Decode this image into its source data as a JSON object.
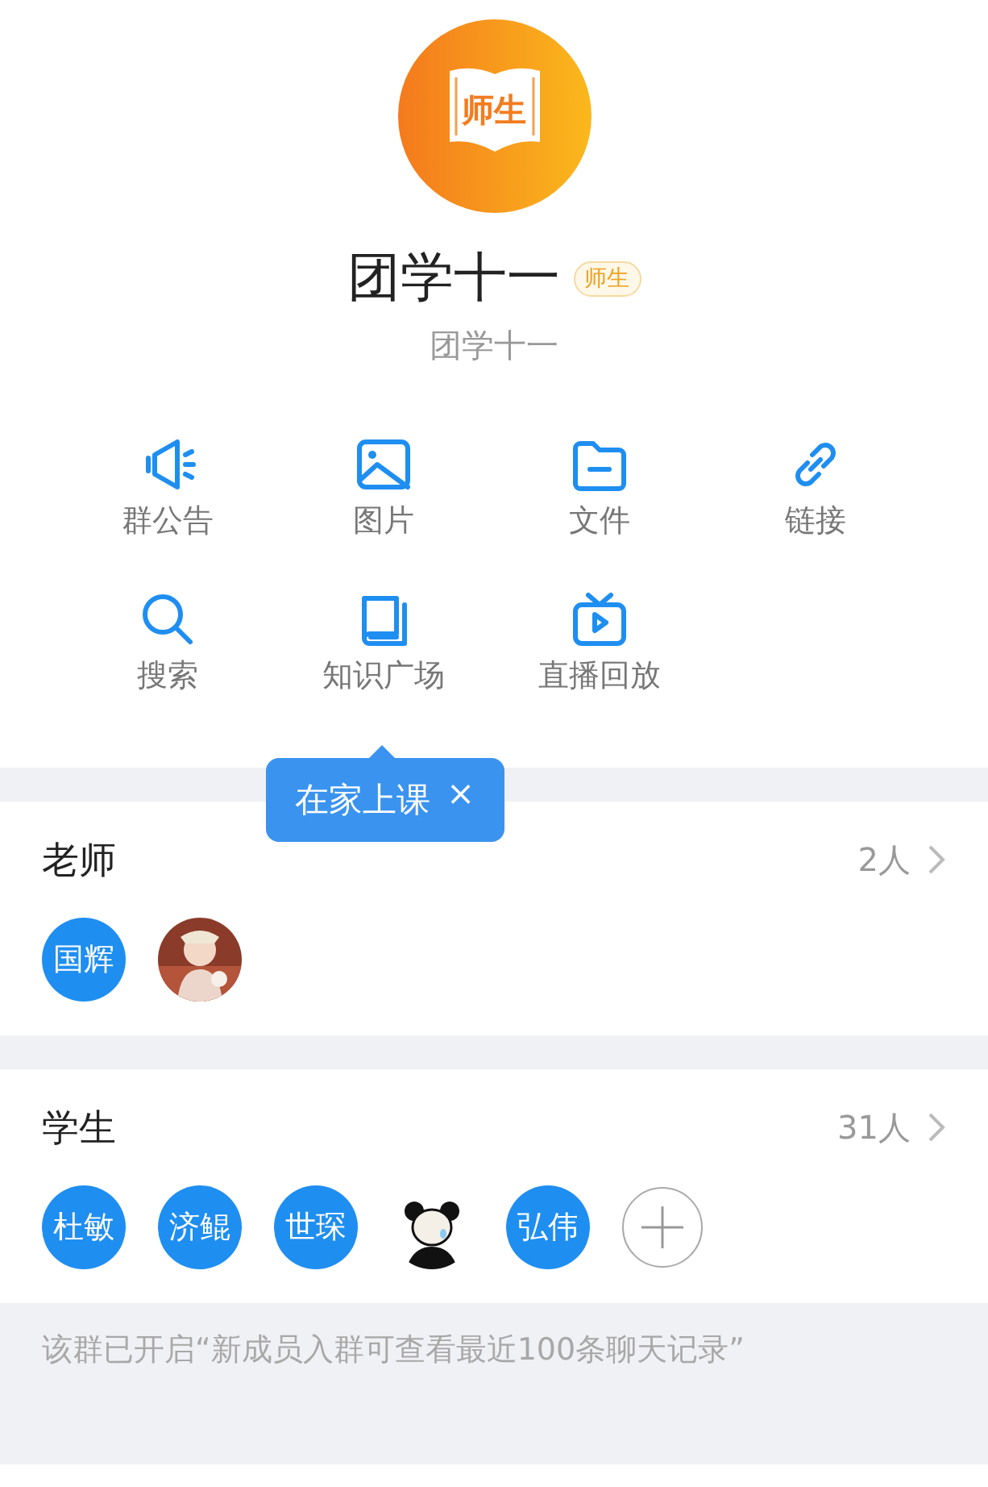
{
  "group": {
    "logo_text": "师生",
    "name": "团学十一",
    "badge": "师生",
    "subtitle": "团学十一"
  },
  "actions": [
    {
      "label": "群公告"
    },
    {
      "label": "图片"
    },
    {
      "label": "文件"
    },
    {
      "label": "链接"
    },
    {
      "label": "搜索"
    },
    {
      "label": "知识广场"
    },
    {
      "label": "直播回放"
    }
  ],
  "tooltip": {
    "text": "在家上课",
    "close": "×"
  },
  "sections": [
    {
      "title": "老师",
      "count": "2人",
      "members": [
        {
          "kind": "name",
          "name": "国辉"
        },
        {
          "kind": "picture"
        }
      ]
    },
    {
      "title": "学生",
      "count": "31人",
      "members": [
        {
          "kind": "name",
          "name": "杜敏"
        },
        {
          "kind": "name",
          "name": "济鲲"
        },
        {
          "kind": "name",
          "name": "世琛"
        },
        {
          "kind": "picture"
        },
        {
          "kind": "name",
          "name": "弘伟"
        },
        {
          "kind": "add"
        }
      ]
    }
  ],
  "footer": "该群已开启“新成员入群可查看最近100条聊天记录”"
}
